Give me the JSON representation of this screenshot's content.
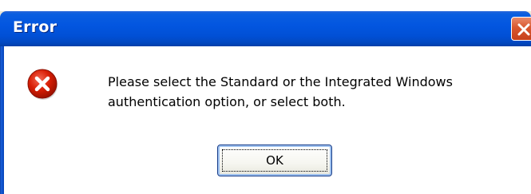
{
  "dialog": {
    "title": "Error",
    "message_line1": "Please select the Standard or the Integrated Windows",
    "message_line2": "authentication option, or select both.",
    "ok_label": "OK",
    "icon": "error-icon",
    "close_icon": "close-icon"
  },
  "colors": {
    "titlebar": "#0356e0",
    "client_background": "#ffffff",
    "error_red": "#d81e05",
    "close_button": "#d9572f"
  }
}
